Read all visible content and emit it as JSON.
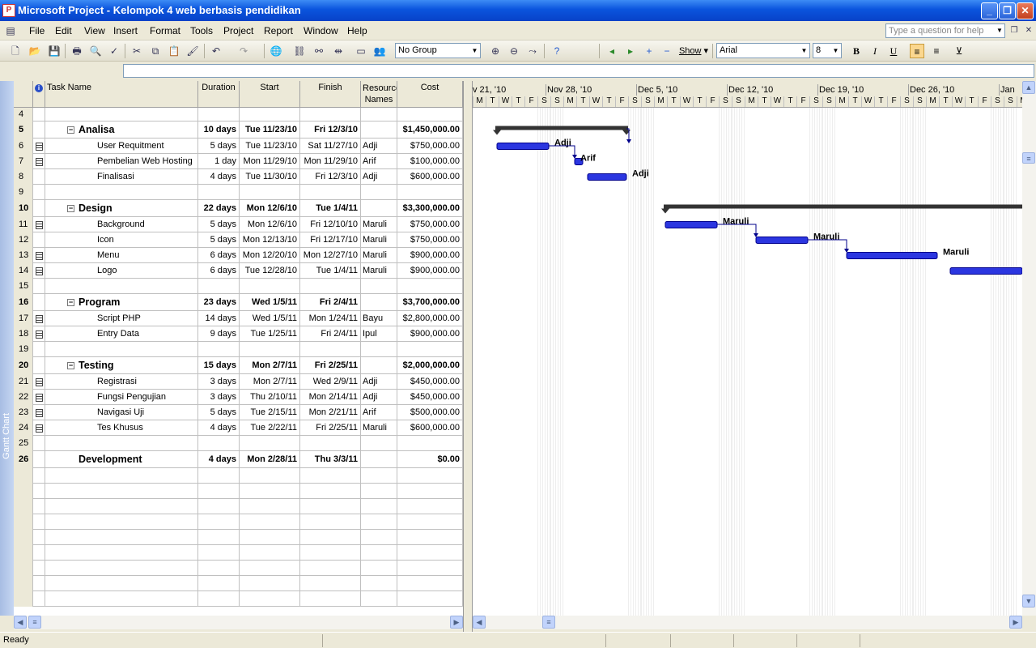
{
  "window": {
    "title": "Microsoft Project - Kelompok 4 web berbasis pendidikan",
    "minimize": "_",
    "restore": "❐",
    "close": "✕"
  },
  "menu": [
    {
      "label": "File",
      "key": "F"
    },
    {
      "label": "Edit",
      "key": "E"
    },
    {
      "label": "View",
      "key": "V"
    },
    {
      "label": "Insert",
      "key": "I"
    },
    {
      "label": "Format",
      "key": "o"
    },
    {
      "label": "Tools",
      "key": "T"
    },
    {
      "label": "Project",
      "key": "P"
    },
    {
      "label": "Report",
      "key": "R"
    },
    {
      "label": "Window",
      "key": "W"
    },
    {
      "label": "Help",
      "key": "H"
    }
  ],
  "help_placeholder": "Type a question for help",
  "toolbar": {
    "group": "No Group",
    "show": "Show",
    "font": "Arial",
    "size": "8",
    "bold": "B",
    "italic": "I",
    "underline": "U"
  },
  "view_bar_label": "Gantt Chart",
  "columns": {
    "name": "Task Name",
    "duration": "Duration",
    "start": "Start",
    "finish": "Finish",
    "resource": "Resource Names",
    "cost": "Cost"
  },
  "tasks": [
    {
      "id": "4",
      "name": "",
      "duration": "",
      "start": "",
      "finish": "",
      "resource": "",
      "cost": "",
      "type": "blank"
    },
    {
      "id": "5",
      "name": "Analisa",
      "duration": "10 days",
      "start": "Tue 11/23/10",
      "finish": "Fri 12/3/10",
      "resource": "",
      "cost": "$1,450,000.00",
      "type": "summary"
    },
    {
      "id": "6",
      "name": "User Requitment",
      "duration": "5 days",
      "start": "Tue 11/23/10",
      "finish": "Sat 11/27/10",
      "resource": "Adji",
      "cost": "$750,000.00",
      "type": "task",
      "note": true
    },
    {
      "id": "7",
      "name": "Pembelian Web Hosting",
      "duration": "1 day",
      "start": "Mon 11/29/10",
      "finish": "Mon 11/29/10",
      "resource": "Arif",
      "cost": "$100,000.00",
      "type": "task",
      "note": true
    },
    {
      "id": "8",
      "name": "Finalisasi",
      "duration": "4 days",
      "start": "Tue 11/30/10",
      "finish": "Fri 12/3/10",
      "resource": "Adji",
      "cost": "$600,000.00",
      "type": "task",
      "note": false
    },
    {
      "id": "9",
      "name": "",
      "duration": "",
      "start": "",
      "finish": "",
      "resource": "",
      "cost": "",
      "type": "blank"
    },
    {
      "id": "10",
      "name": "Design",
      "duration": "22 days",
      "start": "Mon 12/6/10",
      "finish": "Tue 1/4/11",
      "resource": "",
      "cost": "$3,300,000.00",
      "type": "summary"
    },
    {
      "id": "11",
      "name": "Background",
      "duration": "5 days",
      "start": "Mon 12/6/10",
      "finish": "Fri 12/10/10",
      "resource": "Maruli",
      "cost": "$750,000.00",
      "type": "task",
      "note": true
    },
    {
      "id": "12",
      "name": "Icon",
      "duration": "5 days",
      "start": "Mon 12/13/10",
      "finish": "Fri 12/17/10",
      "resource": "Maruli",
      "cost": "$750,000.00",
      "type": "task",
      "note": false
    },
    {
      "id": "13",
      "name": "Menu",
      "duration": "6 days",
      "start": "Mon 12/20/10",
      "finish": "Mon 12/27/10",
      "resource": "Maruli",
      "cost": "$900,000.00",
      "type": "task",
      "note": true
    },
    {
      "id": "14",
      "name": "Logo",
      "duration": "6 days",
      "start": "Tue 12/28/10",
      "finish": "Tue 1/4/11",
      "resource": "Maruli",
      "cost": "$900,000.00",
      "type": "task",
      "note": true
    },
    {
      "id": "15",
      "name": "",
      "duration": "",
      "start": "",
      "finish": "",
      "resource": "",
      "cost": "",
      "type": "blank"
    },
    {
      "id": "16",
      "name": "Program",
      "duration": "23 days",
      "start": "Wed 1/5/11",
      "finish": "Fri 2/4/11",
      "resource": "",
      "cost": "$3,700,000.00",
      "type": "summary"
    },
    {
      "id": "17",
      "name": "Script PHP",
      "duration": "14 days",
      "start": "Wed 1/5/11",
      "finish": "Mon 1/24/11",
      "resource": "Bayu",
      "cost": "$2,800,000.00",
      "type": "task",
      "note": true
    },
    {
      "id": "18",
      "name": "Entry Data",
      "duration": "9 days",
      "start": "Tue 1/25/11",
      "finish": "Fri 2/4/11",
      "resource": "Ipul",
      "cost": "$900,000.00",
      "type": "task",
      "note": true
    },
    {
      "id": "19",
      "name": "",
      "duration": "",
      "start": "",
      "finish": "",
      "resource": "",
      "cost": "",
      "type": "blank"
    },
    {
      "id": "20",
      "name": "Testing",
      "duration": "15 days",
      "start": "Mon 2/7/11",
      "finish": "Fri 2/25/11",
      "resource": "",
      "cost": "$2,000,000.00",
      "type": "summary"
    },
    {
      "id": "21",
      "name": "Registrasi",
      "duration": "3 days",
      "start": "Mon 2/7/11",
      "finish": "Wed 2/9/11",
      "resource": "Adji",
      "cost": "$450,000.00",
      "type": "task",
      "note": true
    },
    {
      "id": "22",
      "name": "Fungsi Pengujian",
      "duration": "3 days",
      "start": "Thu 2/10/11",
      "finish": "Mon 2/14/11",
      "resource": "Adji",
      "cost": "$450,000.00",
      "type": "task",
      "note": true
    },
    {
      "id": "23",
      "name": "Navigasi Uji",
      "duration": "5 days",
      "start": "Tue 2/15/11",
      "finish": "Mon 2/21/11",
      "resource": "Arif",
      "cost": "$500,000.00",
      "type": "task",
      "note": true
    },
    {
      "id": "24",
      "name": "Tes Khusus",
      "duration": "4 days",
      "start": "Tue 2/22/11",
      "finish": "Fri 2/25/11",
      "resource": "Maruli",
      "cost": "$600,000.00",
      "type": "task",
      "note": true
    },
    {
      "id": "25",
      "name": "",
      "duration": "",
      "start": "",
      "finish": "",
      "resource": "",
      "cost": "",
      "type": "blank"
    },
    {
      "id": "26",
      "name": "Development",
      "duration": "4 days",
      "start": "Mon 2/28/11",
      "finish": "Thu 3/3/11",
      "resource": "",
      "cost": "$0.00",
      "type": "milestone-summary"
    }
  ],
  "timescale": {
    "weeks": [
      "v 21, '10",
      "Nov 28, '10",
      "Dec 5, '10",
      "Dec 12, '10",
      "Dec 19, '10",
      "Dec 26, '10",
      "Jan"
    ],
    "day_letters": [
      "M",
      "T",
      "W",
      "T",
      "F",
      "S",
      "S"
    ]
  },
  "gantt_labels": [
    "Adji",
    "Arif",
    "Adji",
    "Maruli",
    "Maruli",
    "Maruli"
  ],
  "status": "Ready",
  "colors": {
    "task_bar": "#2b36e0",
    "summary_bar": "#333333",
    "titlebar": "#0a54dd"
  }
}
